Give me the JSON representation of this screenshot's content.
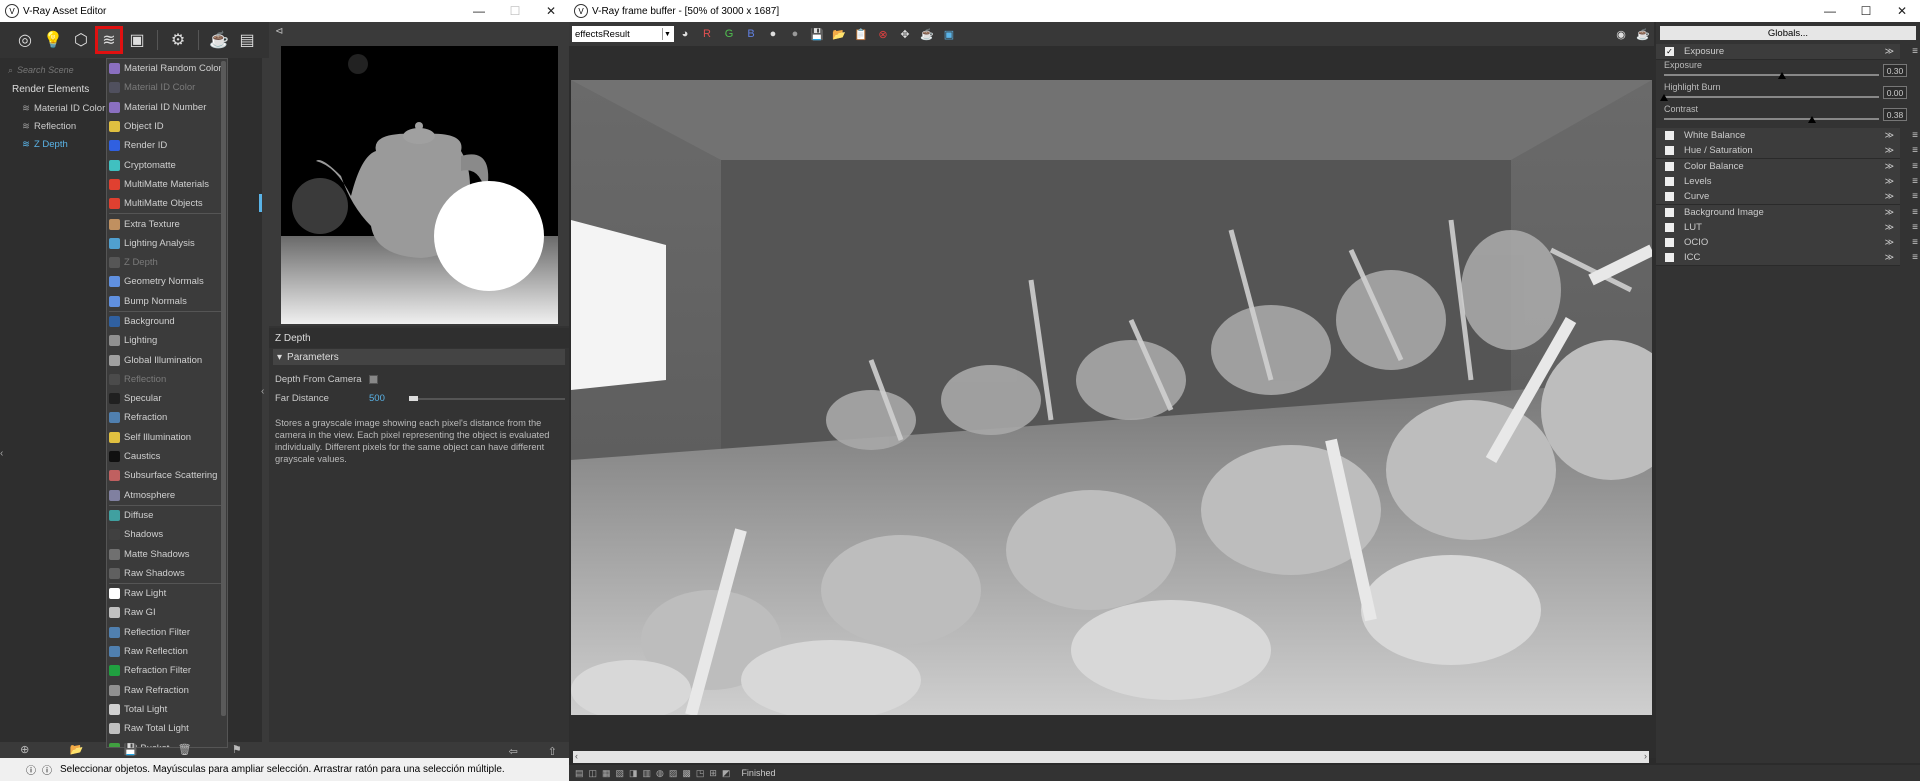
{
  "asset_editor": {
    "title": "V-Ray Asset Editor",
    "search_placeholder": "Search Scene",
    "section_title": "Render Elements",
    "tree": [
      {
        "label": "Material ID Color"
      },
      {
        "label": "Reflection"
      },
      {
        "label": "Z Depth"
      }
    ],
    "dropdown": [
      {
        "label": "Material Random Color",
        "color": "#8a6fc0",
        "disabled": false
      },
      {
        "label": "Material ID Color",
        "color": "#6a6a8a",
        "disabled": true
      },
      {
        "label": "Material ID Number",
        "color": "#8a6fc0",
        "disabled": false
      },
      {
        "label": "Object ID",
        "color": "#e0c040",
        "disabled": false
      },
      {
        "label": "Render ID",
        "color": "#3060e0",
        "disabled": false
      },
      {
        "label": "Cryptomatte",
        "color": "#40c0c0",
        "disabled": false
      },
      {
        "label": "MultiMatte Materials",
        "color": "#e04030",
        "disabled": false
      },
      {
        "label": "MultiMatte Objects",
        "color": "#e04030",
        "disabled": false
      },
      {
        "sep": true
      },
      {
        "label": "Extra Texture",
        "color": "#c09060",
        "disabled": false
      },
      {
        "label": "Lighting Analysis",
        "color": "#50a0d0",
        "disabled": false
      },
      {
        "label": "Z Depth",
        "color": "#777777",
        "disabled": true
      },
      {
        "label": "Geometry Normals",
        "color": "#6090e0",
        "disabled": false
      },
      {
        "label": "Bump Normals",
        "color": "#6090e0",
        "disabled": false
      },
      {
        "sep": true
      },
      {
        "label": "Background",
        "color": "#3060a0",
        "disabled": false
      },
      {
        "label": "Lighting",
        "color": "#909090",
        "disabled": false
      },
      {
        "label": "Global Illumination",
        "color": "#a0a0a0",
        "disabled": false
      },
      {
        "label": "Reflection",
        "color": "#606060",
        "disabled": true
      },
      {
        "label": "Specular",
        "color": "#202020",
        "disabled": false
      },
      {
        "label": "Refraction",
        "color": "#5080b0",
        "disabled": false
      },
      {
        "label": "Self Illumination",
        "color": "#e0c040",
        "disabled": false
      },
      {
        "label": "Caustics",
        "color": "#101010",
        "disabled": false
      },
      {
        "label": "Subsurface Scattering",
        "color": "#c06060",
        "disabled": false
      },
      {
        "label": "Atmosphere",
        "color": "#8080a0",
        "disabled": false
      },
      {
        "sep": true
      },
      {
        "label": "Diffuse",
        "color": "#40a0a0",
        "disabled": false
      },
      {
        "label": "Shadows",
        "color": "#404040",
        "disabled": false
      },
      {
        "label": "Matte Shadows",
        "color": "#707070",
        "disabled": false
      },
      {
        "label": "Raw Shadows",
        "color": "#606060",
        "disabled": false
      },
      {
        "sep": true
      },
      {
        "label": "Raw Light",
        "color": "#ffffff",
        "disabled": false
      },
      {
        "label": "Raw GI",
        "color": "#c0c0c0",
        "disabled": false
      },
      {
        "label": "Reflection Filter",
        "color": "#5080b0",
        "disabled": false
      },
      {
        "label": "Raw Reflection",
        "color": "#5080b0",
        "disabled": false
      },
      {
        "label": "Refraction Filter",
        "color": "#20a040",
        "disabled": false
      },
      {
        "label": "Raw Refraction",
        "color": "#909090",
        "disabled": false
      },
      {
        "label": "Total Light",
        "color": "#d0d0d0",
        "disabled": false
      },
      {
        "label": "Raw Total Light",
        "color": "#c0c0c0",
        "disabled": false
      },
      {
        "label": "DR Bucket",
        "color": "#40a040",
        "disabled": false
      }
    ],
    "props_title": "Z Depth",
    "section": "Parameters",
    "depth_from_camera_label": "Depth From Camera",
    "far_distance_label": "Far Distance",
    "far_distance_value": "500",
    "description": "Stores a grayscale image showing each pixel's distance from the camera in the view. Each pixel representing the object is evaluated individually. Different pixels for the same object can have different grayscale values."
  },
  "vfb": {
    "title": "V-Ray frame buffer - [50% of 3000 x 1687]",
    "channel": "effectsResult",
    "r_label": "R",
    "g_label": "G",
    "b_label": "B",
    "status": "Finished"
  },
  "color_corrections": {
    "globals_label": "Globals...",
    "exposure_label": "Exposure",
    "sliders": [
      {
        "label": "Exposure",
        "value": "0.30",
        "pos": 0.55
      },
      {
        "label": "Highlight Burn",
        "value": "0.00",
        "pos": 0.0
      },
      {
        "label": "Contrast",
        "value": "0.38",
        "pos": 0.69
      }
    ],
    "layers": [
      "White Balance",
      "Hue / Saturation",
      "Color Balance",
      "Levels",
      "Curve",
      "Background Image",
      "LUT",
      "OCIO",
      "ICC"
    ]
  },
  "statusbar": {
    "message": "Seleccionar objetos. Mayúsculas para ampliar selección. Arrastrar ratón para una selección múltiple."
  }
}
